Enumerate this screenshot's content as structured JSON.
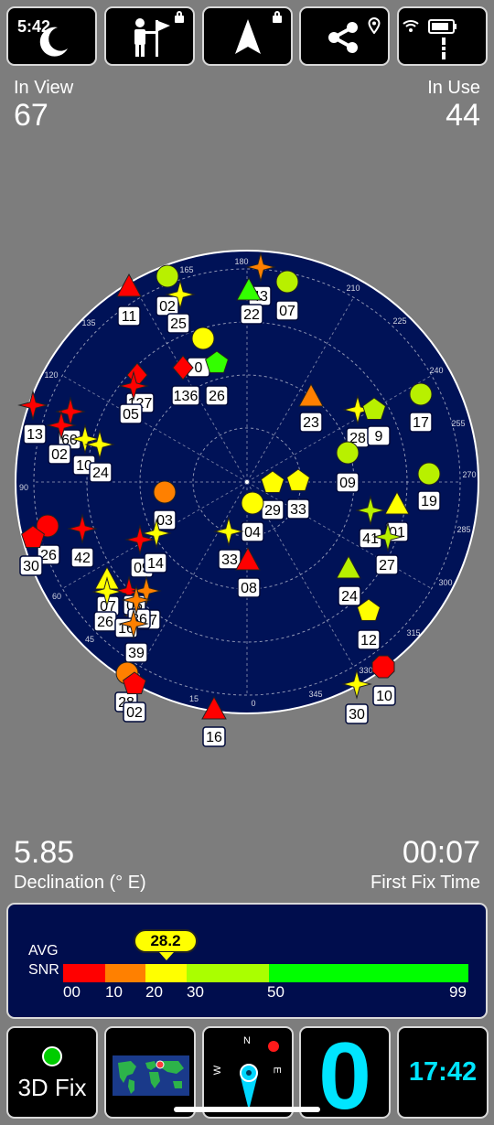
{
  "status_bar": {
    "time": "5:42"
  },
  "top_tiles": [
    {
      "name": "night-mode"
    },
    {
      "name": "lock-task"
    },
    {
      "name": "navigate"
    },
    {
      "name": "share-location"
    },
    {
      "name": "device-status"
    }
  ],
  "stats": {
    "in_view_label": "In View",
    "in_view_value": "67",
    "in_use_label": "In Use",
    "in_use_value": "44",
    "declination_value": "5.85",
    "declination_label": "Declination (° E)",
    "first_fix_value": "00:07",
    "first_fix_label": "First Fix Time"
  },
  "sky_plot": {
    "ring_labels": [
      "180",
      "210",
      "225",
      "240",
      "255",
      "270",
      "285",
      "300",
      "315",
      "330",
      "345",
      "0",
      "15",
      "30",
      "45",
      "60",
      "90",
      "120",
      "135",
      "165"
    ],
    "satellites": [
      {
        "id": "11"
      },
      {
        "id": "02"
      },
      {
        "id": "25"
      },
      {
        "id": "43"
      },
      {
        "id": "22"
      },
      {
        "id": "07"
      },
      {
        "id": "0"
      },
      {
        "id": "26"
      },
      {
        "id": "136"
      },
      {
        "id": "127"
      },
      {
        "id": "05"
      },
      {
        "id": "13"
      },
      {
        "id": "60"
      },
      {
        "id": "02"
      },
      {
        "id": "10"
      },
      {
        "id": "24"
      },
      {
        "id": "23"
      },
      {
        "id": "28"
      },
      {
        "id": "9"
      },
      {
        "id": "17"
      },
      {
        "id": "09"
      },
      {
        "id": "19"
      },
      {
        "id": "03"
      },
      {
        "id": "29"
      },
      {
        "id": "33"
      },
      {
        "id": "04"
      },
      {
        "id": "41"
      },
      {
        "id": "01"
      },
      {
        "id": "26"
      },
      {
        "id": "30"
      },
      {
        "id": "42"
      },
      {
        "id": "09"
      },
      {
        "id": "14"
      },
      {
        "id": "33"
      },
      {
        "id": "08"
      },
      {
        "id": "27"
      },
      {
        "id": "24"
      },
      {
        "id": "07"
      },
      {
        "id": "05"
      },
      {
        "id": "37"
      },
      {
        "id": "26"
      },
      {
        "id": "36"
      },
      {
        "id": "16"
      },
      {
        "id": "39"
      },
      {
        "id": "12"
      },
      {
        "id": "28"
      },
      {
        "id": "02"
      },
      {
        "id": "10"
      },
      {
        "id": "30"
      },
      {
        "id": "16"
      }
    ]
  },
  "snr": {
    "avg_label": "AVG",
    "snr_label": "SNR",
    "avg_value": "28.2",
    "ticks": [
      "00",
      "10",
      "20",
      "30",
      "50",
      "99"
    ],
    "avg": 28.2
  },
  "bottom_tiles": {
    "fix_label": "3D Fix",
    "compass_n": "N",
    "compass_e": "E",
    "compass_w": "W",
    "speed_value": "0",
    "clock": "17:42"
  },
  "colors": {
    "red": "#ff0000",
    "orange": "#ff8000",
    "yellow": "#ffff00",
    "yellowgreen": "#b8f000",
    "green": "#33ff00",
    "accent_cyan": "#00e5ff",
    "fix_green": "#00cc00"
  }
}
